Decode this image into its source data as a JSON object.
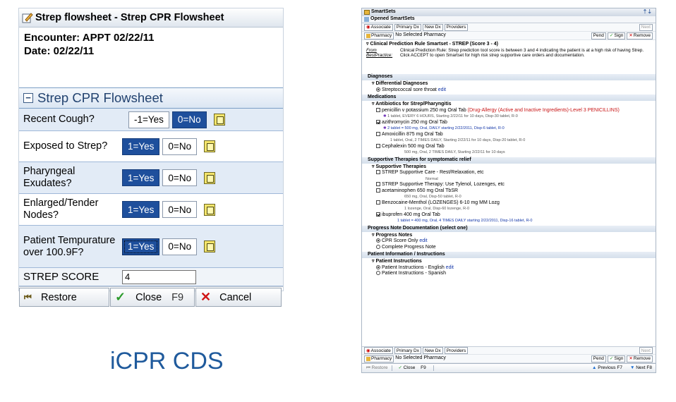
{
  "left": {
    "title": "Strep flowsheet - Strep CPR Flowsheet",
    "encounter": "Encounter: APPT 02/22/11",
    "date": "Date: 02/22/11",
    "section": "Strep CPR Flowsheet",
    "section_toggle": "−",
    "rows": [
      {
        "question": "Recent Cough?",
        "opt_a": "-1=Yes",
        "opt_b": "0=No",
        "selected": "0=No"
      },
      {
        "question": "Exposed to Strep?",
        "opt_a": "1=Yes",
        "opt_b": "0=No",
        "selected": "1=Yes"
      },
      {
        "question": "Pharyngeal Exudates?",
        "opt_a": "1=Yes",
        "opt_b": "0=No",
        "selected": "1=Yes"
      },
      {
        "question": "Enlarged/Tender Nodes?",
        "opt_a": "1=Yes",
        "opt_b": "0=No",
        "selected": "1=Yes"
      },
      {
        "question": "Patient Tempurature over 100.9F?",
        "opt_a": "1=Yes",
        "opt_b": "0=No",
        "selected": "1=Yes"
      }
    ],
    "score_label": "STREP SCORE",
    "score_value": "4",
    "footer": {
      "restore": "Restore",
      "close": "Close",
      "close_key": "F9",
      "cancel": "Cancel"
    }
  },
  "caption": "iCPR CDS",
  "right": {
    "title": "SmartSets",
    "opened": "Opened SmartSets",
    "toolbar": [
      "Associate",
      "Primary Dx",
      "New Dx",
      "Providers"
    ],
    "next": "Next",
    "pharmacy": "Pharmacy",
    "pharmacy_value": "No Selected Pharmacy",
    "actions": [
      "Pend",
      "Sign",
      "Remove"
    ],
    "rule_title": "Clinical Prediction Rule Smartset - STREP (Score 3 - 4)",
    "rule_from": "From BestPractice:",
    "rule_text": "Clinical Prediction Rule: Strep prediction tool score is between 3 and 4 indicating the patient is at a high risk of having Strep. Click ACCEPT to open Smartset for high risk strep supportive care orders and documentation.",
    "sections": {
      "diagnoses": "Diagnoses",
      "differential": "Differential Diagnoses",
      "diagnosis_item": "Streptococcal sore throat",
      "edit": "edit",
      "medications": "Medications",
      "antibiotics": "Antibiotics for Strep/Pharyngitis",
      "supportive": "Supportive Therapies for symptomatic relief",
      "supportive_sub": "Supportive Therapies",
      "progress": "Progress Note Documentation (select one)",
      "progress_sub": "Progress Notes",
      "patient": "Patient Information / Instructions",
      "patient_sub": "Patient Instructions"
    },
    "meds": [
      {
        "name": "penicillin v potassium 250 mg Oral Tab",
        "alert": "(Drug-Allergy (Active and Inactive Ingredients)-Level 3 PENICILLINS)",
        "detail": "1 tablet, EVERY 6 HOURS, Starting 2/22/11 for 10 days, Disp-30 tablet, R-0",
        "checked": false
      },
      {
        "name": "azithromycin 250 mg Oral Tab",
        "detail": "2 tablet = 500 mg, Oral, DAILY starting 2/22/2011, Disp-6 tablet, R-0",
        "checked": true
      },
      {
        "name": "Amoxicillin 875 mg Oral Tab",
        "detail": "1 tablet, Oral, 2 TIMES DAILY, Starting 2/22/11 for 10 days, Disp-20 tablet, R-0",
        "checked": false
      },
      {
        "name": "Cephalexin 500 mg Oral Tab",
        "detail": "500 mg, Oral, 2 TIMES DAILY, Starting 2/22/11 for 10 days",
        "checked": false
      }
    ],
    "therapies": [
      {
        "name": "STREP Supportive Care - Rest/Relaxation, etc",
        "detail": "Normal",
        "checked": false
      },
      {
        "name": "STREP Supportive Therapy: Use Tylenol, Lozenges, etc",
        "detail": "",
        "checked": false
      },
      {
        "name": "acetaminophen 650 mg Oral TbSR",
        "detail": "650 mg, Oral, Disp-50 tablet, R-0",
        "checked": false
      },
      {
        "name": "Benzocaine-Menthol (LOZENGES) 6-10 mg MM Lozg",
        "detail": "1 lozenge, Oral, Disp-60 lozenge, R-0",
        "checked": false
      },
      {
        "name": "ibuprofen 400 mg Oral Tab",
        "detail": "1 tablet = 400 mg, Oral, 4 TIMES DAILY starting 2/22/2011, Disp-16 tablet, R-0",
        "checked": true
      }
    ],
    "progress_notes": [
      {
        "label": "CPR Score Only",
        "selected": true
      },
      {
        "label": "Complete Progress Note",
        "selected": false
      }
    ],
    "patient_instr": [
      {
        "label": "Patient Instructions - English",
        "selected": true
      },
      {
        "label": "Patient Instructions - Spanish",
        "selected": false
      }
    ],
    "footer": {
      "restore": "Restore",
      "close": "Close",
      "close_key": "F9",
      "previous": "Previous",
      "prev_key": "F7",
      "next": "Next",
      "next_key": "F8"
    }
  }
}
